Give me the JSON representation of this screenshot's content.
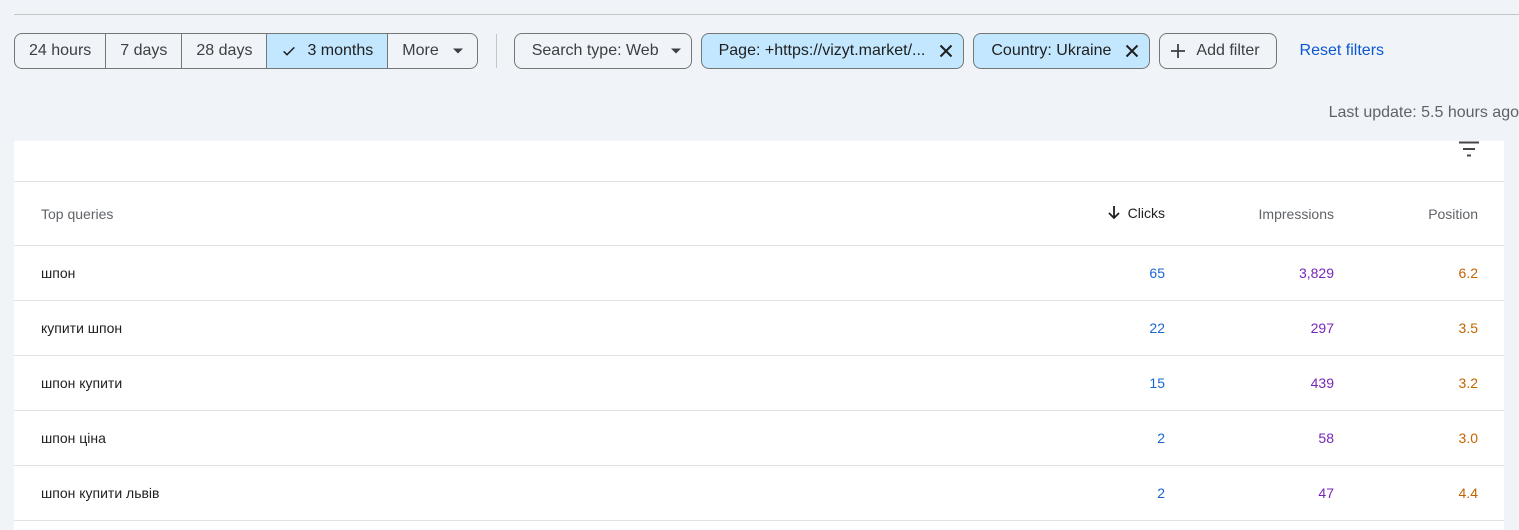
{
  "time_range": {
    "options": [
      {
        "label": "24 hours",
        "selected": false
      },
      {
        "label": "7 days",
        "selected": false
      },
      {
        "label": "28 days",
        "selected": false
      },
      {
        "label": "3 months",
        "selected": true
      }
    ],
    "more_label": "More"
  },
  "filters": {
    "search_type": "Search type: Web",
    "page": "Page: +https://vizyt.market/...",
    "country": "Country: Ukraine",
    "add_filter": "Add filter",
    "reset": "Reset filters"
  },
  "last_update": "Last update: 5.5 hours ago",
  "table": {
    "headers": {
      "query": "Top queries",
      "clicks": "Clicks",
      "impressions": "Impressions",
      "position": "Position"
    },
    "rows": [
      {
        "query": "шпон",
        "clicks": "65",
        "impressions": "3,829",
        "position": "6.2"
      },
      {
        "query": "купити шпон",
        "clicks": "22",
        "impressions": "297",
        "position": "3.5"
      },
      {
        "query": "шпон купити",
        "clicks": "15",
        "impressions": "439",
        "position": "3.2"
      },
      {
        "query": "шпон ціна",
        "clicks": "2",
        "impressions": "58",
        "position": "3.0"
      },
      {
        "query": "шпон купити львів",
        "clicks": "2",
        "impressions": "47",
        "position": "4.4"
      }
    ]
  },
  "colors": {
    "clicks": "#1967d2",
    "impressions": "#7627bb",
    "position": "#c26401",
    "selected_chip": "#c2e7ff",
    "link": "#0b57d0"
  },
  "icons": [
    "check-icon",
    "caret-down-icon",
    "close-icon",
    "plus-icon",
    "filter-list-icon",
    "arrow-down-icon"
  ]
}
